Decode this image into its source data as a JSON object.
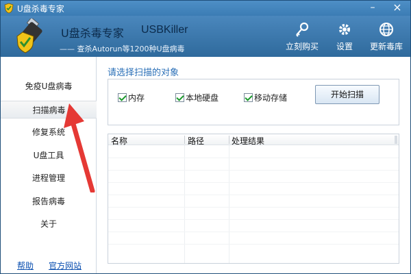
{
  "window": {
    "title": "U盘杀毒专家"
  },
  "header": {
    "app_name": "U盘杀毒专家",
    "app_name_en": "USBKiller",
    "subtitle": "—— 查杀Autorun等1200种U盘病毒",
    "tools": [
      {
        "label": "立刻购买",
        "icon": "key-icon"
      },
      {
        "label": "设置",
        "icon": "gear-icon"
      },
      {
        "label": "更新毒库",
        "icon": "globe-icon"
      }
    ]
  },
  "sidebar": {
    "items": [
      {
        "label": "免疫U盘病毒"
      },
      {
        "label": "扫描病毒",
        "active": true
      },
      {
        "label": "修复系统"
      },
      {
        "label": "U盘工具"
      },
      {
        "label": "进程管理"
      },
      {
        "label": "报告病毒"
      },
      {
        "label": "关于"
      }
    ],
    "links": {
      "help": "帮助",
      "official_site": "官方网站"
    }
  },
  "scan": {
    "section_title": "请选择扫描的对象",
    "options": [
      {
        "label": "内存",
        "checked": true
      },
      {
        "label": "本地硬盘",
        "checked": true
      },
      {
        "label": "移动存储",
        "checked": true
      }
    ],
    "start_button": "开始扫描"
  },
  "results_table": {
    "columns": [
      "名称",
      "路径",
      "处理结果"
    ],
    "rows": []
  },
  "colors": {
    "accent": "#2f6a9c",
    "title_text": "#2a6fb7",
    "check": "#1a9a2a",
    "annotation": "#e53935"
  }
}
